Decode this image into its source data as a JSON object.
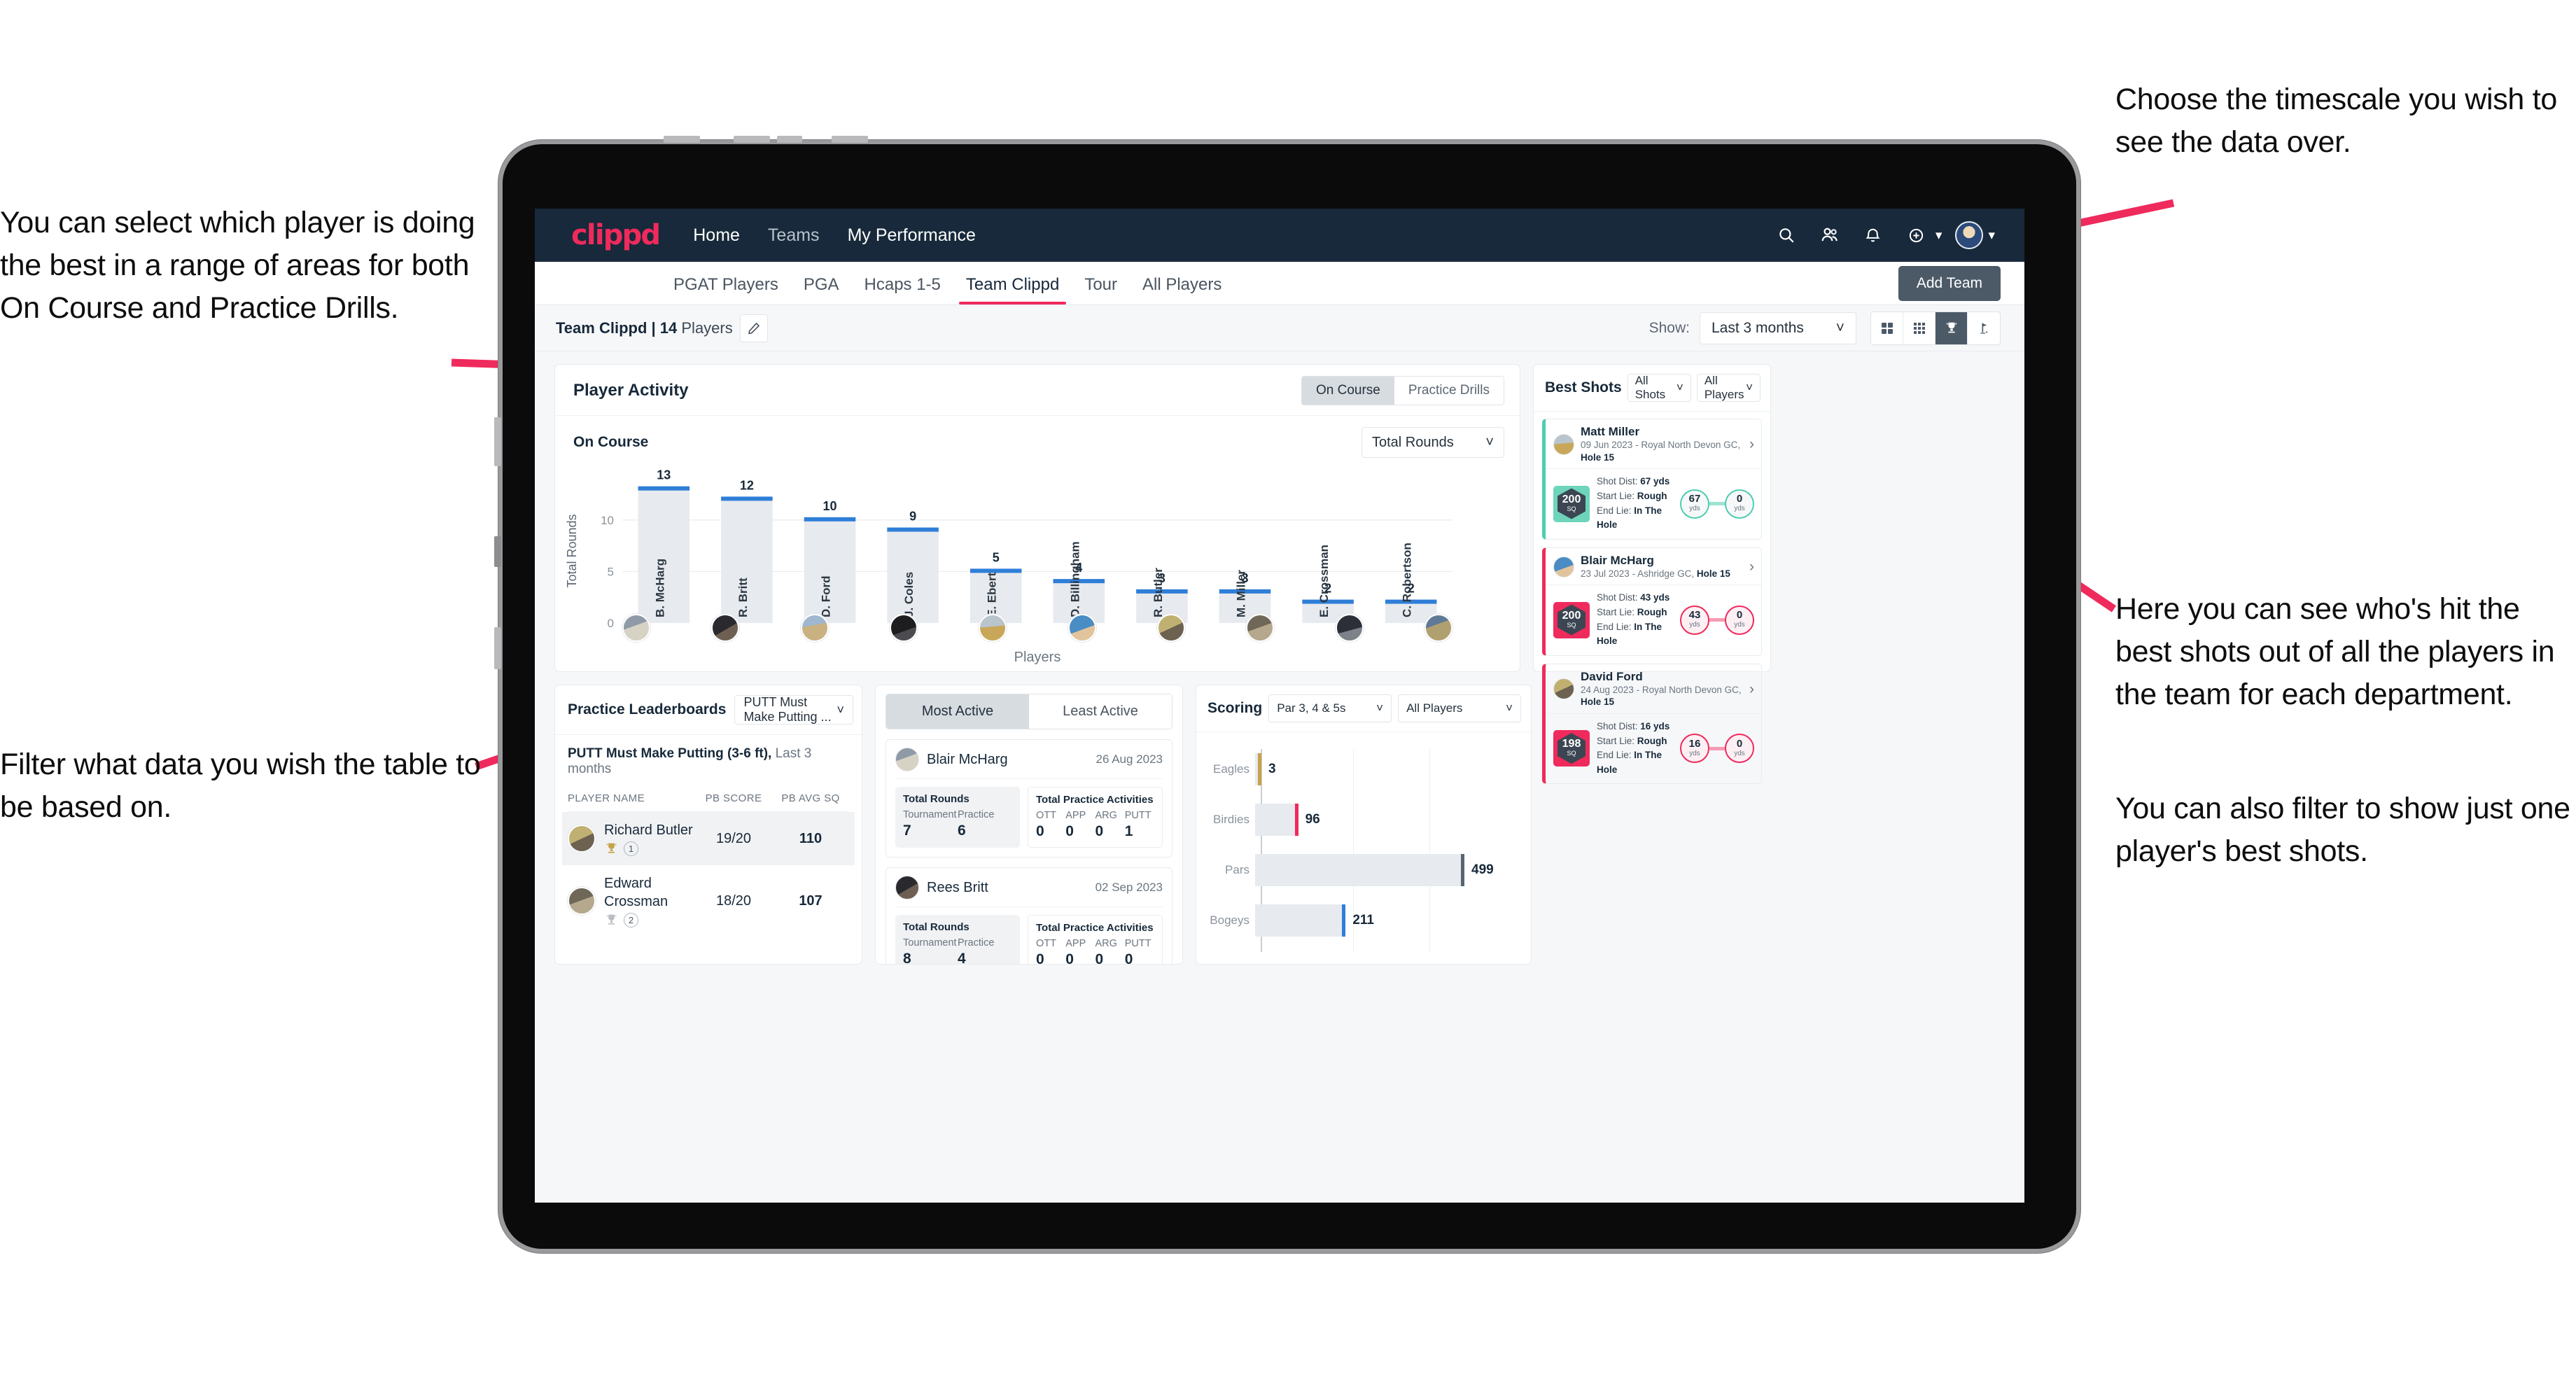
{
  "annotations": {
    "left_top": "You can select which player is doing the best in a range of areas for both On Course and Practice Drills.",
    "left_bottom": "Filter what data you wish the table to be based on.",
    "right_top": "Choose the timescale you wish to see the data over.",
    "right_mid": "Here you can see who's hit the best shots out of all the players in the team for each department.",
    "right_bottom": "You can also filter to show just one player's best shots.",
    "arrow_color": "#ef2a5c"
  },
  "navbar": {
    "logo": "clippd",
    "links": [
      {
        "label": "Home",
        "active": true
      },
      {
        "label": "Teams",
        "active": false
      },
      {
        "label": "My Performance",
        "active": true
      }
    ],
    "icons": [
      "search-icon",
      "people-icon",
      "bell-icon",
      "add-circle-icon",
      "avatar-icon"
    ]
  },
  "tabs": [
    {
      "label": "PGAT Players",
      "active": false
    },
    {
      "label": "PGA",
      "active": false
    },
    {
      "label": "Hcaps 1-5",
      "active": false
    },
    {
      "label": "Team Clippd",
      "active": true
    },
    {
      "label": "Tour",
      "active": false
    },
    {
      "label": "All Players",
      "active": false
    }
  ],
  "add_team_label": "Add Team",
  "subheader": {
    "team_name": "Team Clippd",
    "separator": " | ",
    "player_count": "14",
    "players_word": " Players",
    "edit_icon": "pencil-icon",
    "show_label": "Show:",
    "period_value": "Last 3 months",
    "view_modes": [
      {
        "name": "grid-2x2-icon",
        "active": false
      },
      {
        "name": "grid-3x3-icon",
        "active": false
      },
      {
        "name": "trophy-icon",
        "active": true
      },
      {
        "name": "golf-flag-icon",
        "active": false
      }
    ]
  },
  "player_activity": {
    "title": "Player Activity",
    "segments": [
      {
        "label": "On Course",
        "active": true
      },
      {
        "label": "Practice Drills",
        "active": false
      }
    ],
    "sub_label": "On Course",
    "metric_value": "Total Rounds"
  },
  "chart_data": {
    "type": "bar",
    "title": "Player Activity - On Course",
    "xlabel": "Players",
    "ylabel": "Total Rounds",
    "ylim": [
      0,
      14
    ],
    "yticks": [
      5,
      10
    ],
    "grid": true,
    "categories": [
      "B. McHarg",
      "R. Britt",
      "D. Ford",
      "J. Coles",
      "E. Ebert",
      "D. Billingham",
      "R. Butler",
      "M. Miller",
      "E. Crossman",
      "C. Robertson"
    ],
    "values": [
      13,
      12,
      10,
      9,
      5,
      4,
      3,
      3,
      2,
      2
    ],
    "bar_color": "#e7eaee",
    "cap_color": "#2f7ed8"
  },
  "best_shots": {
    "title": "Best Shots",
    "shot_filter": "All Shots",
    "player_filter": "All Players",
    "cards": [
      {
        "player": "Matt Miller",
        "meta_date": "09 Jun 2023",
        "meta_course": " - Royal North Devon GC, ",
        "meta_hole": "Hole 15",
        "sq_value": "200",
        "sq_unit": "SQ",
        "accent": "teal",
        "shot_dist_label": "Shot Dist: ",
        "shot_dist": "67 yds",
        "start_lie_label": "Start Lie: ",
        "start_lie": "Rough",
        "end_lie_label": "End Lie: ",
        "end_lie": "In The Hole",
        "from_val": "67",
        "from_unit": "yds",
        "to_val": "0",
        "to_unit": "yds"
      },
      {
        "player": "Blair McHarg",
        "meta_date": "23 Jul 2023",
        "meta_course": " - Ashridge GC, ",
        "meta_hole": "Hole 15",
        "sq_value": "200",
        "sq_unit": "SQ",
        "accent": "pink",
        "shot_dist_label": "Shot Dist: ",
        "shot_dist": "43 yds",
        "start_lie_label": "Start Lie: ",
        "start_lie": "Rough",
        "end_lie_label": "End Lie: ",
        "end_lie": "In The Hole",
        "from_val": "43",
        "from_unit": "yds",
        "to_val": "0",
        "to_unit": "yds"
      },
      {
        "player": "David Ford",
        "meta_date": "24 Aug 2023",
        "meta_course": " - Royal North Devon GC, ",
        "meta_hole": "Hole 15",
        "sq_value": "198",
        "sq_unit": "SQ",
        "accent": "pink",
        "shot_dist_label": "Shot Dist: ",
        "shot_dist": "16 yds",
        "start_lie_label": "Start Lie: ",
        "start_lie": "Rough",
        "end_lie_label": "End Lie: ",
        "end_lie": "In The Hole",
        "from_val": "16",
        "from_unit": "yds",
        "to_val": "0",
        "to_unit": "yds"
      }
    ]
  },
  "practice_leaderboards": {
    "title": "Practice Leaderboards",
    "drill_select": "PUTT Must Make Putting ...",
    "subtitle_bold": "PUTT Must Make Putting (3-6 ft),",
    "subtitle_light": " Last 3 months",
    "columns": [
      "PLAYER NAME",
      "PB SCORE",
      "PB AVG SQ"
    ],
    "rows": [
      {
        "name": "Richard Butler",
        "rank": "1",
        "trophy": "gold",
        "pb_score": "19/20",
        "pb_avg_sq": "110",
        "highlight": true
      },
      {
        "name": "Edward Crossman",
        "rank": "2",
        "trophy": "silver",
        "pb_score": "18/20",
        "pb_avg_sq": "107",
        "highlight": false
      }
    ]
  },
  "activity_panel": {
    "tabs": [
      {
        "label": "Most Active",
        "active": true
      },
      {
        "label": "Least Active",
        "active": false
      }
    ],
    "items": [
      {
        "player": "Blair McHarg",
        "date": "26 Aug 2023",
        "rounds_title": "Total Rounds",
        "rounds": [
          {
            "key": "Tournament",
            "val": "7"
          },
          {
            "key": "Practice",
            "val": "6"
          }
        ],
        "practice_title": "Total Practice Activities",
        "practice": [
          {
            "key": "OTT",
            "val": "0"
          },
          {
            "key": "APP",
            "val": "0"
          },
          {
            "key": "ARG",
            "val": "0"
          },
          {
            "key": "PUTT",
            "val": "1"
          }
        ]
      },
      {
        "player": "Rees Britt",
        "date": "02 Sep 2023",
        "rounds_title": "Total Rounds",
        "rounds": [
          {
            "key": "Tournament",
            "val": "8"
          },
          {
            "key": "Practice",
            "val": "4"
          }
        ],
        "practice_title": "Total Practice Activities",
        "practice": [
          {
            "key": "OTT",
            "val": "0"
          },
          {
            "key": "APP",
            "val": "0"
          },
          {
            "key": "ARG",
            "val": "0"
          },
          {
            "key": "PUTT",
            "val": "0"
          }
        ]
      }
    ]
  },
  "scoring": {
    "title": "Scoring",
    "par_filter": "Par 3, 4 & 5s",
    "player_filter": "All Players",
    "chart": {
      "type": "bar",
      "orientation": "horizontal",
      "categories": [
        "Eagles",
        "Birdies",
        "Pars",
        "Bogeys"
      ],
      "values": [
        3,
        96,
        499,
        211
      ],
      "xlim": [
        0,
        560
      ],
      "colors": [
        "#c6a24a",
        "#ef2a5c",
        "#5a6570",
        "#2f7ed8"
      ],
      "bar_bg": "#e7eaee",
      "grid": true
    }
  }
}
